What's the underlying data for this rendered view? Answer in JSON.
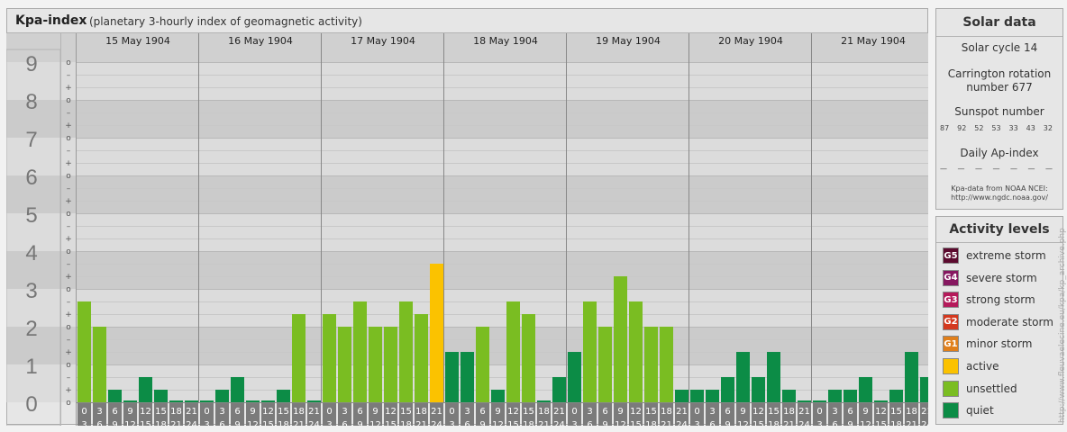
{
  "header": {
    "title": "Kpa-index",
    "subtitle": "(planetary 3-hourly index of geomagnetic activity)"
  },
  "chart_data": {
    "type": "bar",
    "ylim": [
      0,
      9
    ],
    "y_ticks": [
      "0",
      "1",
      "2",
      "3",
      "4",
      "5",
      "6",
      "7",
      "8",
      "9"
    ],
    "sub_ticks": [
      "o",
      "+",
      "–"
    ],
    "days": [
      "15 May 1904",
      "16 May 1904",
      "17 May 1904",
      "18 May 1904",
      "19 May 1904",
      "20 May 1904",
      "21 May 1904"
    ],
    "interval_labels": [
      [
        "0",
        "3"
      ],
      [
        "3",
        "6"
      ],
      [
        "6",
        "9"
      ],
      [
        "9",
        "12"
      ],
      [
        "12",
        "15"
      ],
      [
        "15",
        "18"
      ],
      [
        "18",
        "21"
      ],
      [
        "21",
        "24"
      ]
    ],
    "values": [
      [
        2.667,
        2.0,
        0.333,
        0.0,
        0.667,
        0.333,
        0.0,
        0.0
      ],
      [
        0.0,
        0.333,
        0.667,
        0.0,
        0.0,
        0.333,
        2.333,
        0.0
      ],
      [
        2.333,
        2.0,
        2.667,
        2.0,
        2.0,
        2.667,
        2.333,
        3.667
      ],
      [
        1.333,
        1.333,
        2.0,
        0.333,
        2.667,
        2.333,
        0.0,
        0.667
      ],
      [
        1.333,
        2.667,
        2.0,
        3.333,
        2.667,
        2.0,
        2.0,
        0.333
      ],
      [
        0.333,
        0.333,
        0.667,
        1.333,
        0.667,
        1.333,
        0.333,
        0.0
      ],
      [
        0.0,
        0.333,
        0.333,
        0.667,
        0.0,
        0.333,
        1.333,
        0.667
      ]
    ],
    "colors": {
      "quiet": "#0c8c46",
      "unsettled": "#7abd22",
      "active": "#fbc200",
      "minor": "#e07f1b",
      "moderate": "#d4381e",
      "strong": "#b5195a",
      "severe": "#861860",
      "extreme": "#5c0a2e"
    }
  },
  "solar": {
    "title": "Solar data",
    "cycle": "Solar cycle 14",
    "carrington_line1": "Carrington rotation",
    "carrington_line2": "number 677",
    "sunspot_title": "Sunspot number",
    "sunspots": [
      "87",
      "92",
      "52",
      "53",
      "33",
      "43",
      "32"
    ],
    "ap_title": "Daily Ap-index",
    "ap_values": [
      "—",
      "—",
      "—",
      "—",
      "—",
      "—",
      "—"
    ],
    "source_line1": "Kpa-data from NOAA NCEI:",
    "source_line2": "http://www.ngdc.noaa.gov/"
  },
  "legend": {
    "title": "Activity levels",
    "items": [
      {
        "code": "G5",
        "label": "extreme storm",
        "color": "#5c0a2e"
      },
      {
        "code": "G4",
        "label": "severe storm",
        "color": "#861860"
      },
      {
        "code": "G3",
        "label": "strong storm",
        "color": "#b5195a"
      },
      {
        "code": "G2",
        "label": "moderate storm",
        "color": "#d4381e"
      },
      {
        "code": "G1",
        "label": "minor storm",
        "color": "#e07f1b"
      },
      {
        "code": "",
        "label": "active",
        "color": "#fbc200"
      },
      {
        "code": "",
        "label": "unsettled",
        "color": "#7abd22"
      },
      {
        "code": "",
        "label": "quiet",
        "color": "#0c8c46"
      }
    ]
  },
  "watermark": "http://www.fleuvaelecine.eu/kpa/kp_archive.php"
}
